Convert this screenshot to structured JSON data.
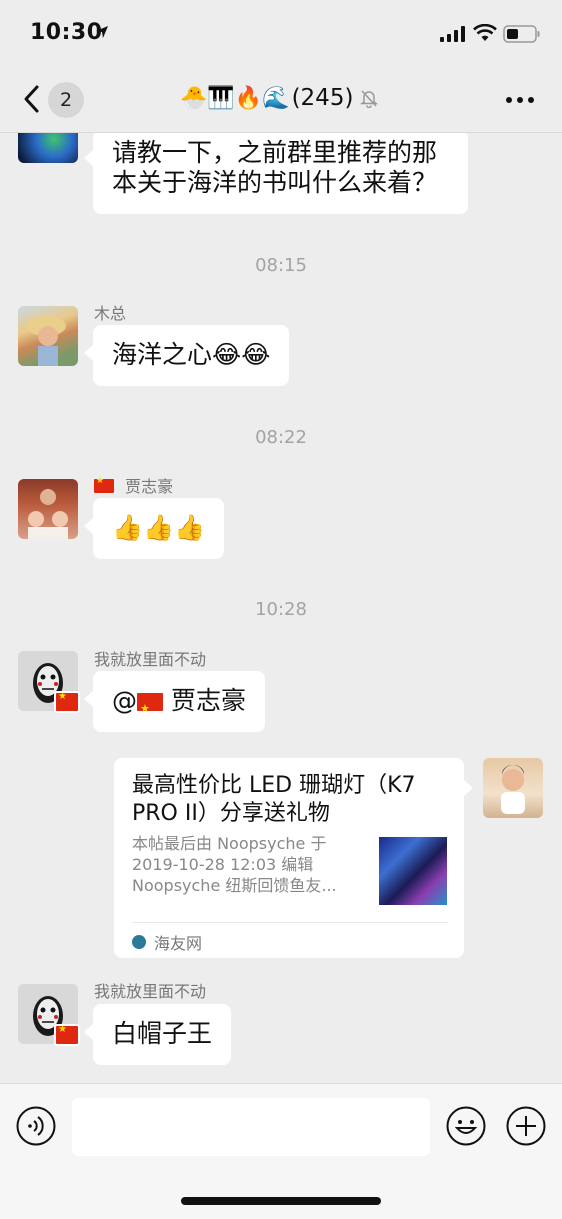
{
  "status_bar": {
    "time": "10:30"
  },
  "nav": {
    "back_count": "2",
    "title_emoji": "🐣🎹🔥🌊",
    "title_count": "(245)"
  },
  "messages": [
    {
      "type": "text",
      "side": "left",
      "text_lines": [
        "请教一下，之前群里推荐的那",
        "本关于海洋的书叫什么来着？"
      ]
    },
    {
      "type": "time",
      "text": "08:15"
    },
    {
      "type": "text",
      "side": "left",
      "sender": "木总",
      "text": "海洋之心😂😂"
    },
    {
      "type": "time",
      "text": "08:22"
    },
    {
      "type": "text",
      "side": "left",
      "sender": "贾志豪",
      "sender_flag": true,
      "text": "👍👍👍"
    },
    {
      "type": "time",
      "text": "10:28"
    },
    {
      "type": "text",
      "side": "left",
      "sender": "我就放里面不动",
      "text_prefix": "@",
      "text": " 贾志豪"
    },
    {
      "type": "link",
      "side": "right",
      "title": "最高性价比 LED 珊瑚灯（K7 PRO II）分享送礼物",
      "desc_lines": [
        "本帖最后由 Noopsyche 于",
        "2019-10-28 12:03 编辑",
        "Noopsyche 纽斯回馈鱼友..."
      ],
      "source": "海友网"
    },
    {
      "type": "text",
      "side": "left",
      "sender": "我就放里面不动",
      "text": "白帽子王"
    }
  ]
}
